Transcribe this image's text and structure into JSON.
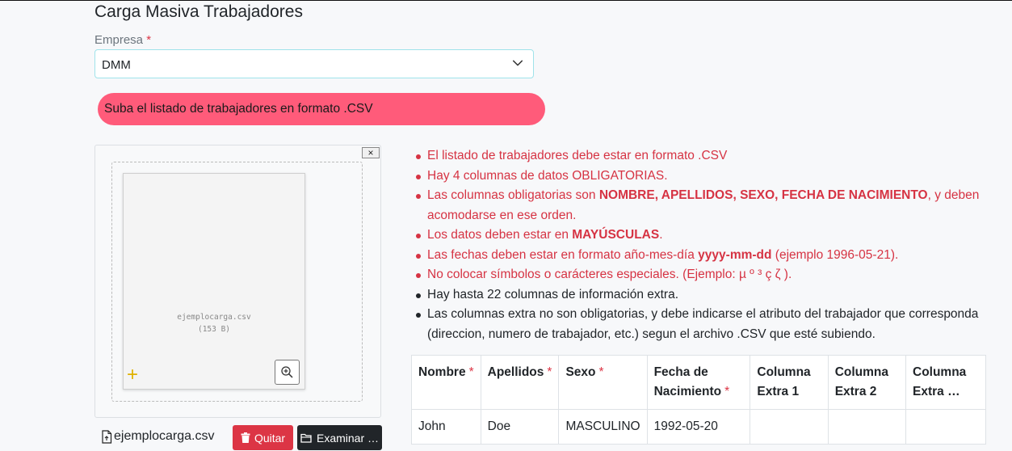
{
  "page": {
    "title": "Carga Masiva Trabajadores"
  },
  "company": {
    "label": "Empresa",
    "required_mark": "*",
    "selected": "DMM"
  },
  "alert": {
    "text": "Suba el listado de trabajadores en formato .CSV"
  },
  "uploader": {
    "close_label": "×",
    "file_name": "ejemplocarga.csv",
    "file_size": "(153 B)",
    "caption_name": "ejemplocarga.csv",
    "remove_label": "Quitar",
    "browse_label": "Examinar …"
  },
  "rules": [
    {
      "tone": "red",
      "parts": [
        {
          "t": "El listado de trabajadores debe estar en formato .CSV"
        }
      ]
    },
    {
      "tone": "red",
      "parts": [
        {
          "t": "Hay 4 columnas de datos OBLIGATORIAS."
        }
      ]
    },
    {
      "tone": "red",
      "parts": [
        {
          "t": "Las columnas obligatorias son "
        },
        {
          "t": "NOMBRE, APELLIDOS, SEXO, FECHA DE NACIMIENTO",
          "b": true
        },
        {
          "t": ", y deben acomodarse en ese orden."
        }
      ]
    },
    {
      "tone": "red",
      "parts": [
        {
          "t": "Los datos deben estar en "
        },
        {
          "t": "MAYÚSCULAS",
          "b": true
        },
        {
          "t": "."
        }
      ]
    },
    {
      "tone": "red",
      "parts": [
        {
          "t": "Las fechas deben estar en formato año-mes-día "
        },
        {
          "t": "yyyy-mm-dd",
          "b": true
        },
        {
          "t": " (ejemplo 1996-05-21)."
        }
      ]
    },
    {
      "tone": "red",
      "parts": [
        {
          "t": "No colocar símbolos o carácteres especiales. (Ejemplo: µ º ³ ç ζ )."
        }
      ]
    },
    {
      "tone": "dark",
      "parts": [
        {
          "t": "Hay hasta 22 columnas de información extra."
        }
      ]
    },
    {
      "tone": "dark",
      "parts": [
        {
          "t": "Las columnas extra no son obligatorias, y debe indicarse el atributo del trabajador que corresponda (direccion, numero de trabajador, etc.) segun el archivo .CSV que esté subiendo."
        }
      ]
    }
  ],
  "table": {
    "required_mark": "*",
    "headers": [
      {
        "label": "Nombre",
        "required": true
      },
      {
        "label": "Apellidos",
        "required": true
      },
      {
        "label": "Sexo",
        "required": true
      },
      {
        "label": "Fecha de Nacimiento",
        "required": true
      },
      {
        "label": "Columna Extra 1",
        "required": false
      },
      {
        "label": "Columna Extra 2",
        "required": false
      },
      {
        "label": "Columna Extra …",
        "required": false
      }
    ],
    "rows": [
      [
        "John",
        "Doe",
        "MASCULINO",
        "1992-05-20",
        "",
        "",
        ""
      ]
    ]
  },
  "colors": {
    "alert": "#ff5b7a",
    "danger": "#dc3545",
    "dark_button": "#212529",
    "select_border": "#9fe3ea"
  },
  "icons": [
    "chevron-down-icon",
    "close-icon",
    "zoom-icon",
    "add-icon",
    "file-icon",
    "trash-icon",
    "folder-icon"
  ]
}
